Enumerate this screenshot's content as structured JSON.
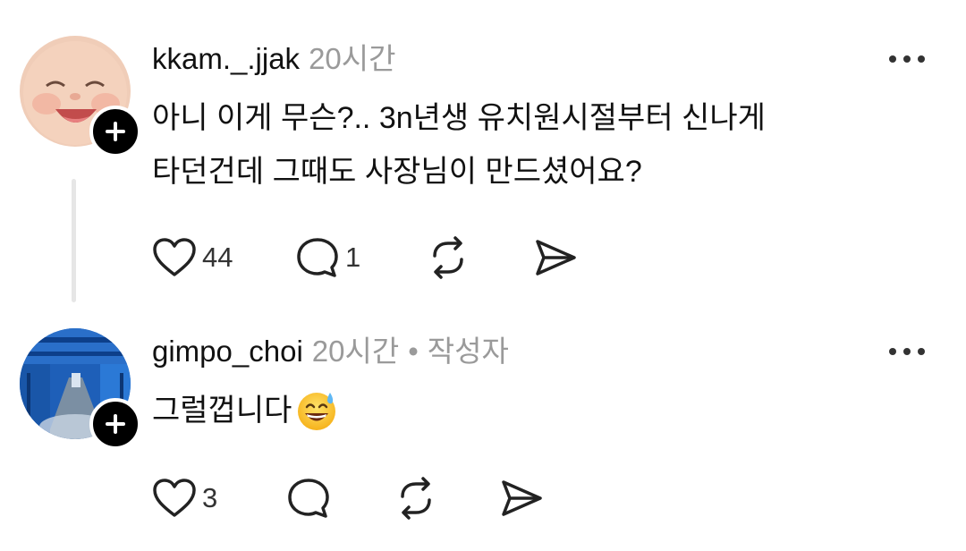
{
  "posts": [
    {
      "username": "kkam._.jjak",
      "time": "20시간",
      "text_lines": [
        "아니 이게 무슨?.. 3n년생 유치원시절부터 신나게",
        "타던건데 그때도 사장님이 만드셨어요?"
      ],
      "likes": "44",
      "replies": "1"
    },
    {
      "username": "gimpo_choi",
      "time": "20시간",
      "separator": "•",
      "author_tag": "작성자",
      "text": "그럴껍니다",
      "likes": "3"
    }
  ],
  "icons": {
    "like": "heart-icon",
    "reply": "speech-bubble-icon",
    "repost": "repost-icon",
    "share": "send-icon",
    "more": "more-icon",
    "follow": "plus-icon",
    "emoji": "sweat-smile-emoji"
  }
}
